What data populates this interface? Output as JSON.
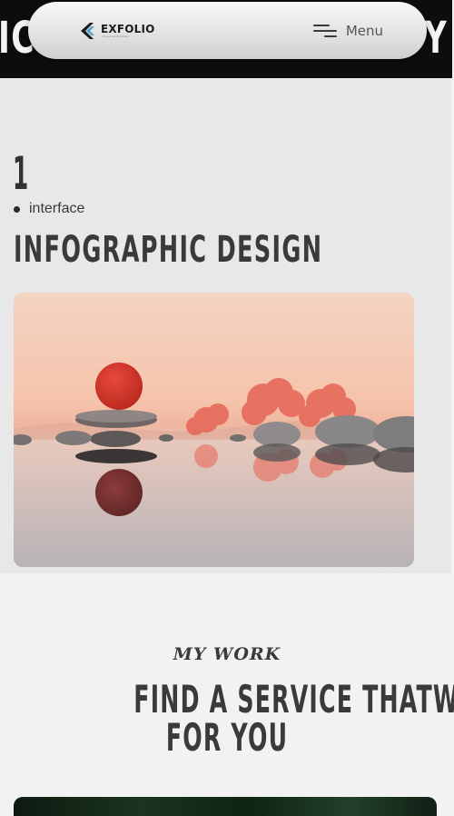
{
  "nav": {
    "logo_text": "EXFOLIO",
    "logo_tagline": "Personal Portfolio",
    "menu_label": "Menu"
  },
  "marquee": {
    "left_text": "ICE",
    "right_text": "Y"
  },
  "service": {
    "number": "1",
    "tag": "interface",
    "title": "INFOGRAPHIC DESIGN"
  },
  "work": {
    "eyebrow": "MY WORK",
    "heading_line1": "FIND A SERVICE THATWORKS",
    "heading_line2": "FOR YOU"
  },
  "colors": {
    "dark": "#0d0d0d",
    "text": "#3a3a3a",
    "section_bg": "#e8e8e8",
    "page_bg": "#f2f2f2",
    "accent_red": "#d2382c"
  },
  "icons": {
    "menu": "hamburger-icon",
    "arrow": "arrow-up-right-icon",
    "logo": "exfolio-logo-icon"
  }
}
